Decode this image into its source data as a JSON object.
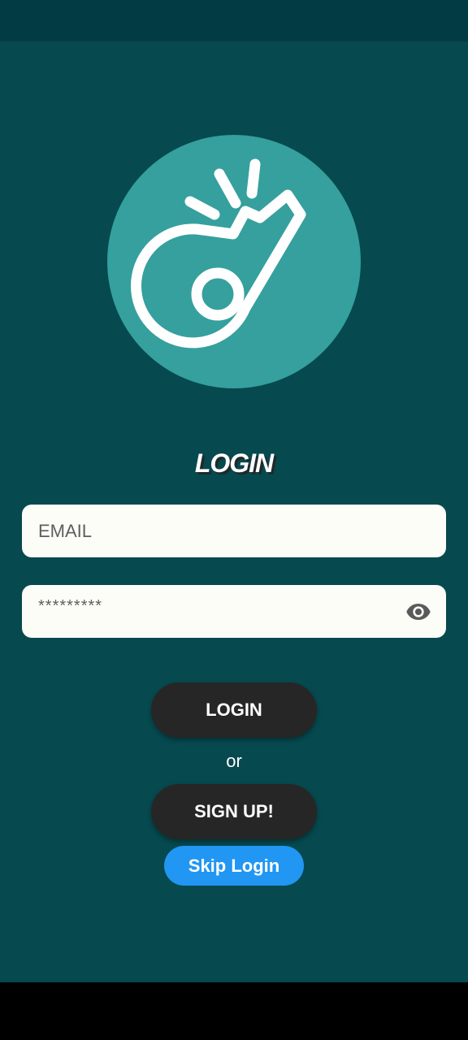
{
  "title": "LOGIN",
  "email": {
    "placeholder": "EMAIL",
    "value": ""
  },
  "password": {
    "display": "*********",
    "toggle_icon": "eye-icon"
  },
  "buttons": {
    "login": "LOGIN",
    "or": "or",
    "signup": "SIGN UP!",
    "skip": "Skip Login"
  },
  "logo": {
    "icon": "whistle-icon"
  },
  "colors": {
    "background": "#06494f",
    "status_bar": "#033b44",
    "logo_circle": "#35a09d",
    "field": "#fdfdf8",
    "pill_button": "#262626",
    "skip_button": "#2196f3"
  }
}
